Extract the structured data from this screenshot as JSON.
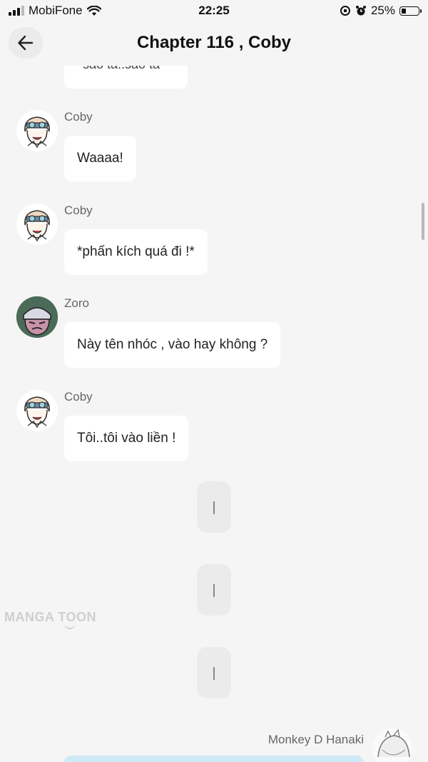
{
  "status_bar": {
    "carrier": "MobiFone",
    "time": "22:25",
    "battery": "25%",
    "battery_level": 0.25
  },
  "header": {
    "title": "Chapter 116 , Coby",
    "back_icon": "arrow-left-icon"
  },
  "messages": [
    {
      "sender": "",
      "text": "sao ta..sao ta",
      "partial": true
    },
    {
      "sender": "Coby",
      "text": "Waaaa!"
    },
    {
      "sender": "Coby",
      "text": "*phấn kích quá đi !*"
    },
    {
      "sender": "Zoro",
      "text": "Này tên nhóc , vào hay không ?"
    },
    {
      "sender": "Coby",
      "text": "Tôi..tôi vào liền !"
    }
  ],
  "typing_indicators": 3,
  "watermark": "MANGA TOON",
  "right_message": {
    "sender": "Monkey D Hanaki"
  },
  "colors": {
    "background": "#f5f5f5",
    "bubble": "#ffffff",
    "right_bubble": "#cdeaf6"
  }
}
